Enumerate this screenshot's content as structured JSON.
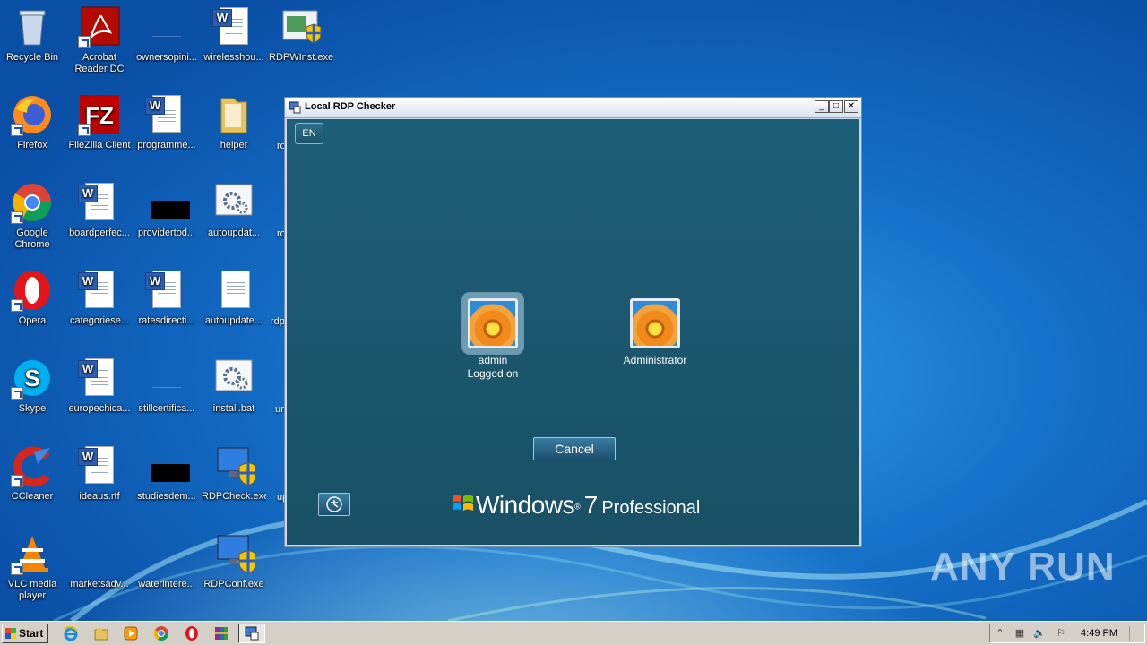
{
  "desktop": {
    "icons": [
      {
        "label": "Recycle Bin"
      },
      {
        "label": "Acrobat\nReader DC"
      },
      {
        "label": "ownersopini..."
      },
      {
        "label": "wirelesshou..."
      },
      {
        "label": "RDPWInst.exe"
      },
      {
        "label": "Firefox"
      },
      {
        "label": "FileZilla Client"
      },
      {
        "label": "programme..."
      },
      {
        "label": "helper"
      },
      {
        "label": "Google\nChrome"
      },
      {
        "label": "boardperfec..."
      },
      {
        "label": "providertod..."
      },
      {
        "label": "autoupdat..."
      },
      {
        "label": "Opera"
      },
      {
        "label": "categoriese..."
      },
      {
        "label": "ratesdirecti..."
      },
      {
        "label": "autoupdate..."
      },
      {
        "label": "Skype"
      },
      {
        "label": "europechica..."
      },
      {
        "label": "stillcertifica..."
      },
      {
        "label": "install.bat"
      },
      {
        "label": "CCleaner"
      },
      {
        "label": "ideaus.rtf"
      },
      {
        "label": "studiesdem..."
      },
      {
        "label": "RDPCheck.exe"
      },
      {
        "label": "VLC media\nplayer"
      },
      {
        "label": "marketsadv..."
      },
      {
        "label": "waterintere..."
      },
      {
        "label": "RDPConf.exe"
      }
    ],
    "partial_labels": [
      "ro",
      "ro",
      "rdp",
      "un",
      "up"
    ]
  },
  "window": {
    "title": "Local RDP Checker",
    "language_button": "EN",
    "users": [
      {
        "name": "admin",
        "status": "Logged on"
      },
      {
        "name": "Administrator",
        "status": ""
      }
    ],
    "cancel_label": "Cancel",
    "brand": {
      "windows": "Windows",
      "version": "7",
      "edition": "Professional"
    }
  },
  "taskbar": {
    "start_label": "Start",
    "clock": "4:49 PM"
  },
  "watermark": "ANY RUN"
}
